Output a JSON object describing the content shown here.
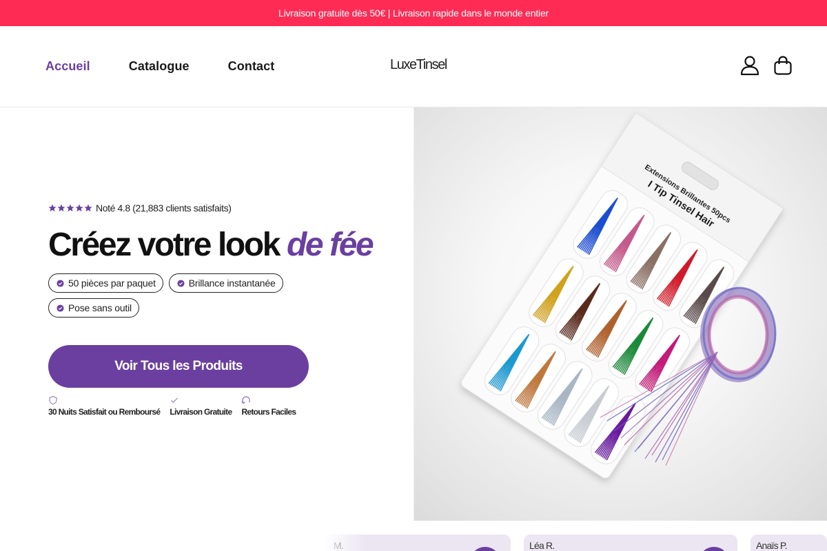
{
  "announcement": {
    "text": "Livraison gratuite dès 50€ | Livraison rapide dans le monde entier"
  },
  "header": {
    "nav": [
      {
        "label": "Accueil",
        "active": true
      },
      {
        "label": "Catalogue",
        "active": false
      },
      {
        "label": "Contact",
        "active": false
      }
    ],
    "logo": "LuxeTinsel",
    "icons": [
      "account-icon",
      "cart-bag-icon"
    ]
  },
  "hero": {
    "rating": {
      "stars": 5,
      "text": "Noté 4.8 (21,883 clients satisfaits)"
    },
    "headline": {
      "main": "Créez votre look ",
      "accent": "de fée"
    },
    "features": [
      "50 pièces par paquet",
      "Brillance instantanée",
      "Pose sans outil"
    ],
    "cta_label": "Voir Tous les Produits",
    "guarantees": [
      {
        "icon": "shield-icon",
        "label": "30 Nuits Satisfait ou Remboursé"
      },
      {
        "icon": "check-icon",
        "label": "Livraison Gratuite"
      },
      {
        "icon": "return-icon",
        "label": "Retours Faciles"
      }
    ],
    "image": {
      "package_title": "Extensions Brillantes 50pcs",
      "package_subtitle": "I Tip Tinsel Hair"
    }
  },
  "reviews": [
    {
      "name": "M."
    },
    {
      "name": "Léa R."
    },
    {
      "name": "Anaïs P."
    }
  ],
  "colors": {
    "accent": "#6b3fa0",
    "announcement_bg": "#fe2c55"
  }
}
